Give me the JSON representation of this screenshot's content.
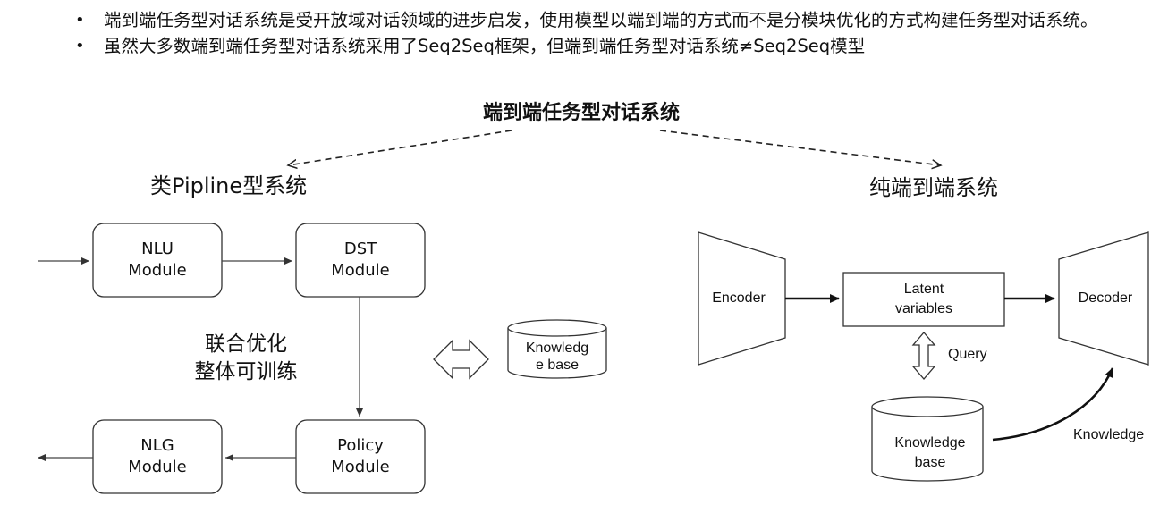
{
  "bullets": [
    "端到端任务型对话系统是受开放域对话领域的进步启发，使用模型以端到端的方式而不是分模块优化的方式构建任务型对话系统。",
    "虽然大多数端到端任务型对话系统采用了Seq2Seq框架，但端到端任务型对话系统≠Seq2Seq模型"
  ],
  "title": "端到端任务型对话系统",
  "left": {
    "title": "类Pipline型系统",
    "nlu": [
      "NLU",
      "Module"
    ],
    "dst": [
      "DST",
      "Module"
    ],
    "nlg": [
      "NLG",
      "Module"
    ],
    "policy": [
      "Policy",
      "Module"
    ],
    "joint": [
      "联合优化",
      "整体可训练"
    ],
    "kb": [
      "Knowledg",
      "e base"
    ]
  },
  "right": {
    "title": "纯端到端系统",
    "encoder": "Encoder",
    "latent": [
      "Latent",
      "variables"
    ],
    "decoder": "Decoder",
    "query": "Query",
    "kb": [
      "Knowledge",
      "base"
    ],
    "knowledge": "Knowledge"
  }
}
